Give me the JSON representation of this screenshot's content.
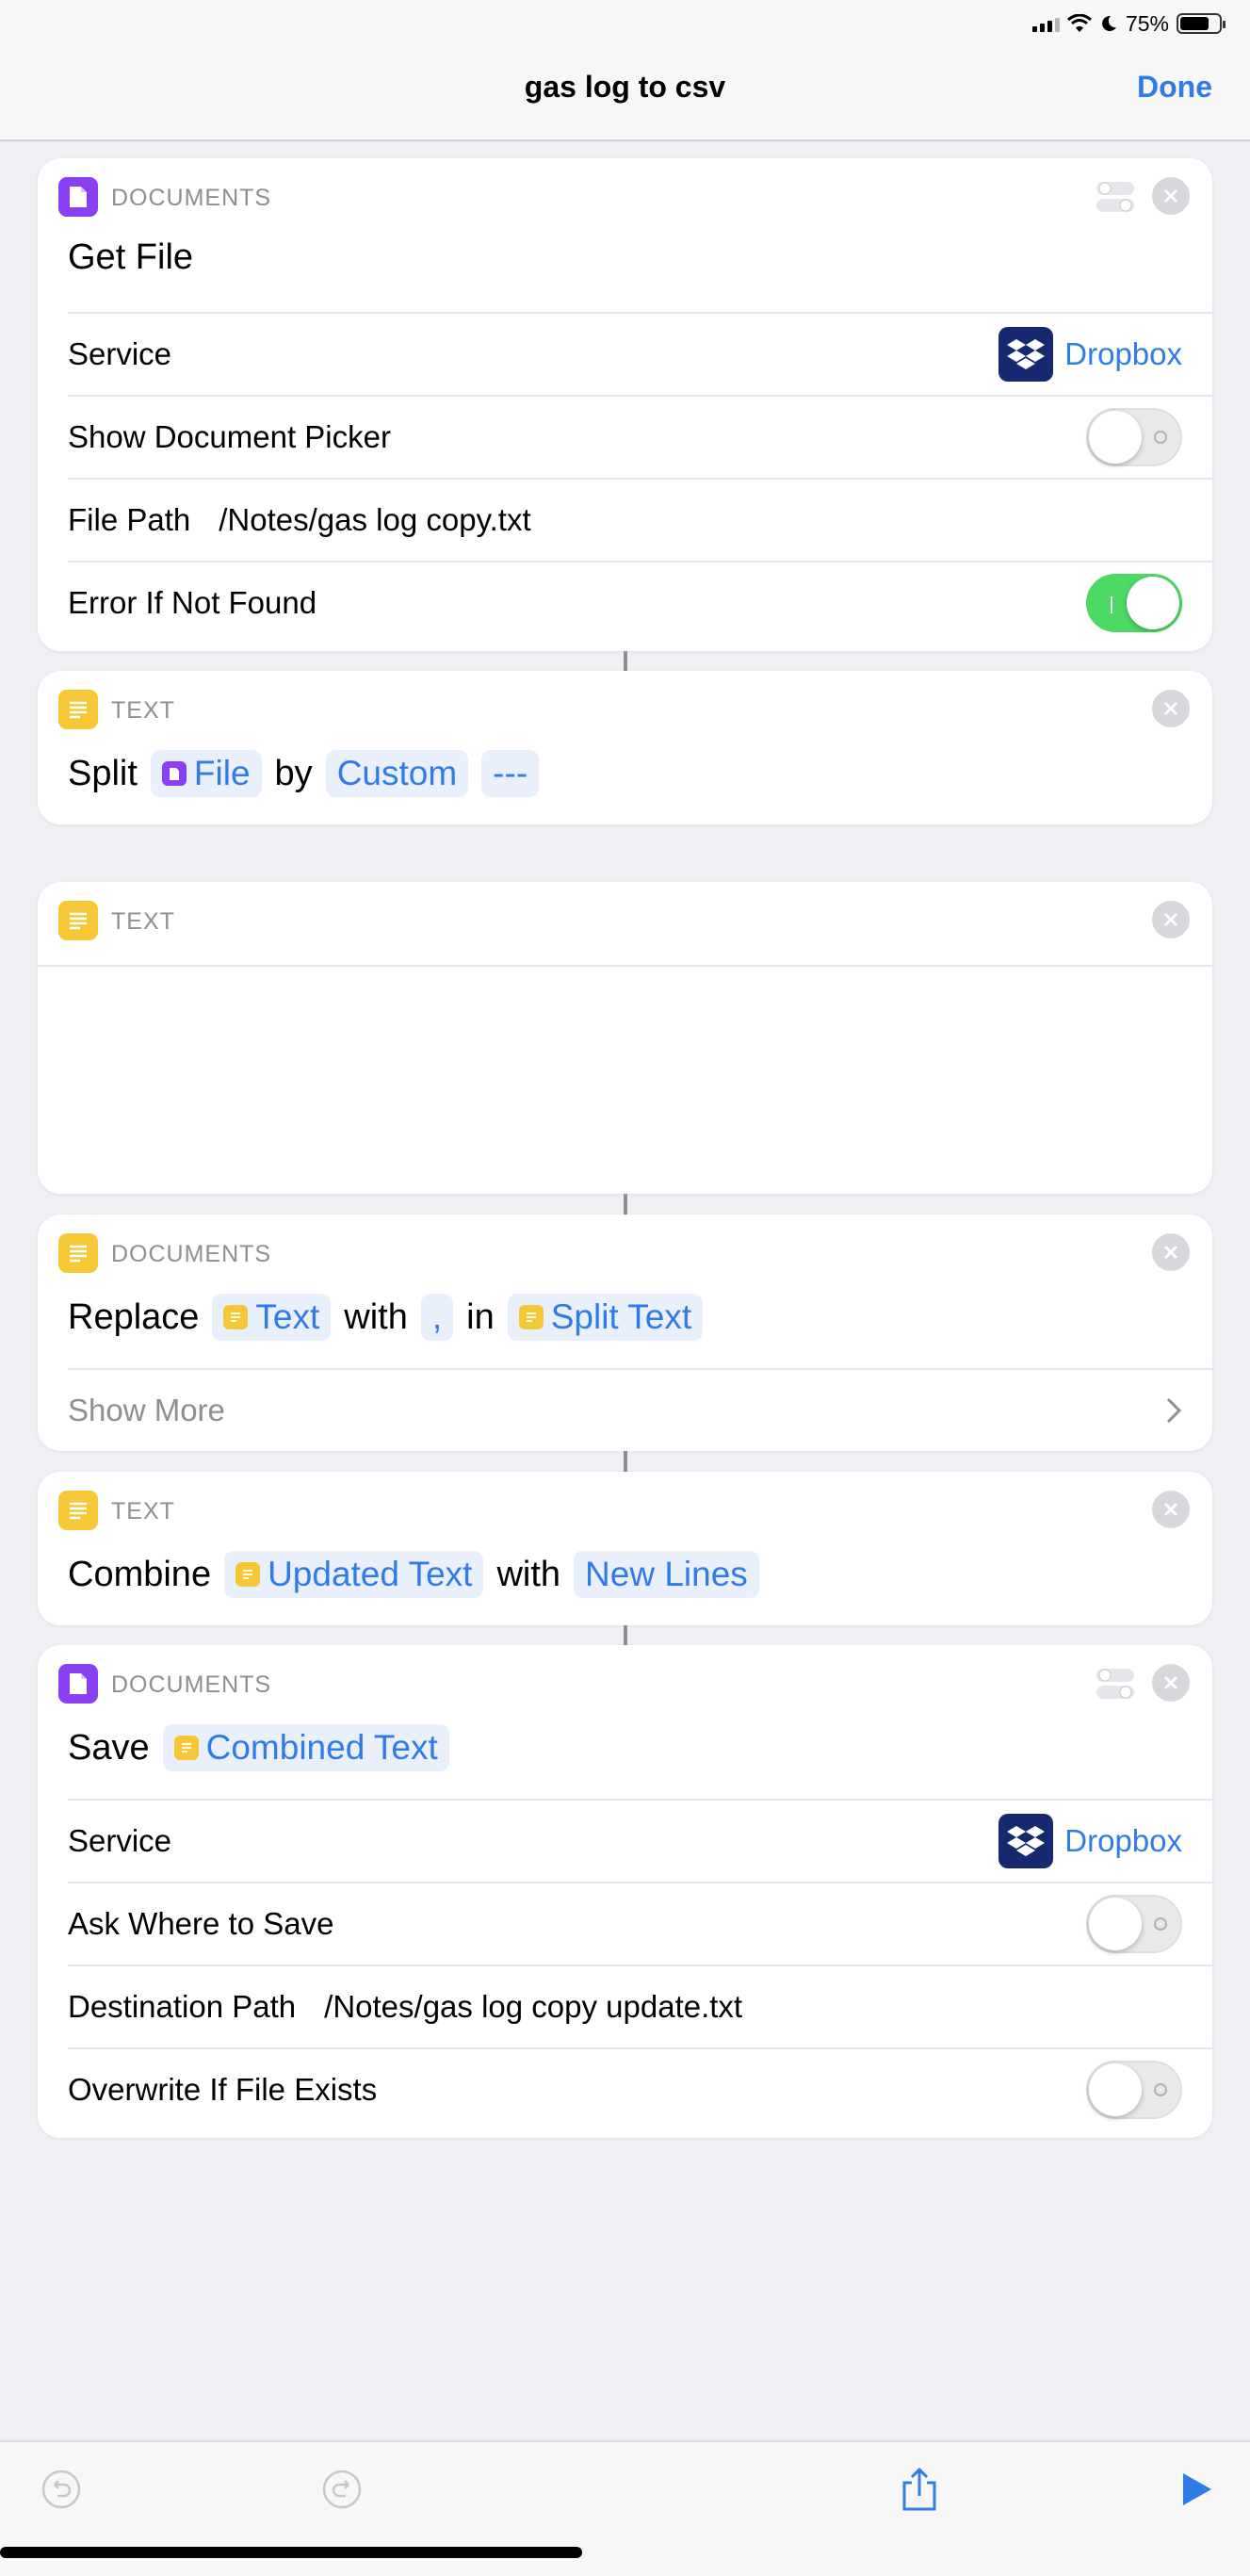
{
  "status": {
    "battery_text": "75%",
    "battery_level": 0.75
  },
  "nav": {
    "title": "gas log to csv",
    "done_label": "Done"
  },
  "actions": {
    "get_file": {
      "category": "DOCUMENTS",
      "title": "Get File",
      "service_label": "Service",
      "service_value": "Dropbox",
      "picker_label": "Show Document Picker",
      "picker_on": false,
      "path_label": "File Path",
      "path_value": "/Notes/gas log copy.txt",
      "error_label": "Error If Not Found",
      "error_on": true
    },
    "split": {
      "category": "TEXT",
      "verb": "Split",
      "token_file": "File",
      "by": "by",
      "token_custom": "Custom",
      "token_sep": "---"
    },
    "text": {
      "category": "TEXT"
    },
    "replace": {
      "category": "DOCUMENTS",
      "verb": "Replace",
      "token_text": "Text",
      "with": "with",
      "token_comma": ",",
      "in": "in",
      "token_split": "Split Text",
      "show_more": "Show More"
    },
    "combine": {
      "category": "TEXT",
      "verb": "Combine",
      "token_updated": "Updated Text",
      "with": "with",
      "token_newlines": "New Lines"
    },
    "save": {
      "category": "DOCUMENTS",
      "verb": "Save",
      "token_combined": "Combined Text",
      "service_label": "Service",
      "service_value": "Dropbox",
      "ask_label": "Ask Where to Save",
      "ask_on": false,
      "dest_label": "Destination Path",
      "dest_value": "/Notes/gas log copy update.txt",
      "overwrite_label": "Overwrite If File Exists",
      "overwrite_on": false
    }
  },
  "colors": {
    "accent": "#2f7ce6",
    "docs": "#8a3ff0",
    "text": "#f6c736",
    "toggle_on": "#4cd964"
  },
  "icons": {
    "undo": "undo-icon",
    "redo": "redo-icon",
    "share": "share-icon",
    "play": "play-icon",
    "close": "close-icon",
    "dropbox": "dropbox-icon"
  }
}
